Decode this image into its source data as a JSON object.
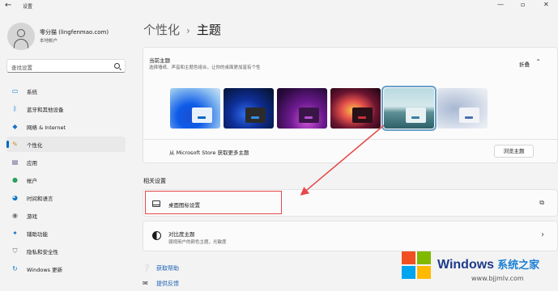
{
  "window": {
    "title": "设置",
    "back_glyph": "←",
    "minimize_glyph": "—",
    "maximize_glyph": "▫",
    "close_glyph": "✕"
  },
  "user": {
    "name": "零分猫 (lingfenmao.com)",
    "account_type": "本地帐户"
  },
  "search": {
    "placeholder": "查找设置"
  },
  "sidebar": {
    "items": [
      {
        "label": "系统",
        "icon": "monitor-icon",
        "glyph": "▭",
        "color": "#0078d4"
      },
      {
        "label": "蓝牙和其他设备",
        "icon": "bluetooth-icon",
        "glyph": "ᛒ",
        "color": "#0078d4"
      },
      {
        "label": "网络 & Internet",
        "icon": "wifi-icon",
        "glyph": "◆",
        "color": "#1a73c8"
      },
      {
        "label": "个性化",
        "icon": "brush-icon",
        "glyph": "✎",
        "color": "#d4882a",
        "selected": true
      },
      {
        "label": "应用",
        "icon": "apps-icon",
        "glyph": "▤",
        "color": "#5a5a8a"
      },
      {
        "label": "帐户",
        "icon": "account-icon",
        "glyph": "●",
        "color": "#2f9e60"
      },
      {
        "label": "时间和语言",
        "icon": "globe-clock-icon",
        "glyph": "◕",
        "color": "#0a78c8"
      },
      {
        "label": "游戏",
        "icon": "gamepad-icon",
        "glyph": "◉",
        "color": "#707070"
      },
      {
        "label": "辅助功能",
        "icon": "accessibility-icon",
        "glyph": "✦",
        "color": "#1a6fc0"
      },
      {
        "label": "隐私和安全性",
        "icon": "shield-icon",
        "glyph": "⛉",
        "color": "#6a6a6a"
      },
      {
        "label": "Windows 更新",
        "icon": "update-icon",
        "glyph": "↻",
        "color": "#0a78c8"
      }
    ]
  },
  "header": {
    "parent": "个性化",
    "separator": "›",
    "current": "主题"
  },
  "current_theme": {
    "title": "当前主题",
    "description": "选择墙纸、声音和主题色组合，让你的桌面更加富有个性",
    "collapse_label": "折叠",
    "collapse_glyph": "⌃",
    "themes": [
      {
        "name": "windows-light",
        "selected": false,
        "window_color": "#e8f1fb",
        "accent": "#0067c0"
      },
      {
        "name": "windows-dark",
        "selected": false,
        "window_color": "#2b2b2b",
        "accent": "#3a8ee6"
      },
      {
        "name": "glow",
        "selected": false,
        "window_color": "#3a1648",
        "accent": "#b34fd0"
      },
      {
        "name": "captured-motion",
        "selected": false,
        "window_color": "#2a1018",
        "accent": "#c8323a"
      },
      {
        "name": "sunrise",
        "selected": true,
        "window_color": "#e7f1f3",
        "accent": "#3a7ea0"
      },
      {
        "name": "flow",
        "selected": false,
        "window_color": "#f1f3f7",
        "accent": "#4a6fb0"
      }
    ],
    "store_text": "从 Microsoft Store 获取更多主题",
    "browse_label": "浏览主题"
  },
  "related": {
    "section_title": "相关设置",
    "desktop_icons": {
      "title": "桌面图标设置",
      "ext_glyph": "⧉"
    },
    "contrast": {
      "title": "对比度主题",
      "description": "弱视用户的颜色主题，光敏度",
      "chevron": "›"
    }
  },
  "help": {
    "get_help": "获取帮助",
    "feedback": "提供反馈",
    "help_glyph": "❔",
    "feedback_glyph": "✉"
  },
  "watermark": {
    "brand": "Windows",
    "brand_cn": "系统之家",
    "url": "www.bjjmlv.com"
  },
  "colors": {
    "accent": "#0067c0",
    "annotation_red": "#e5494a",
    "link": "#1a5fb4"
  }
}
